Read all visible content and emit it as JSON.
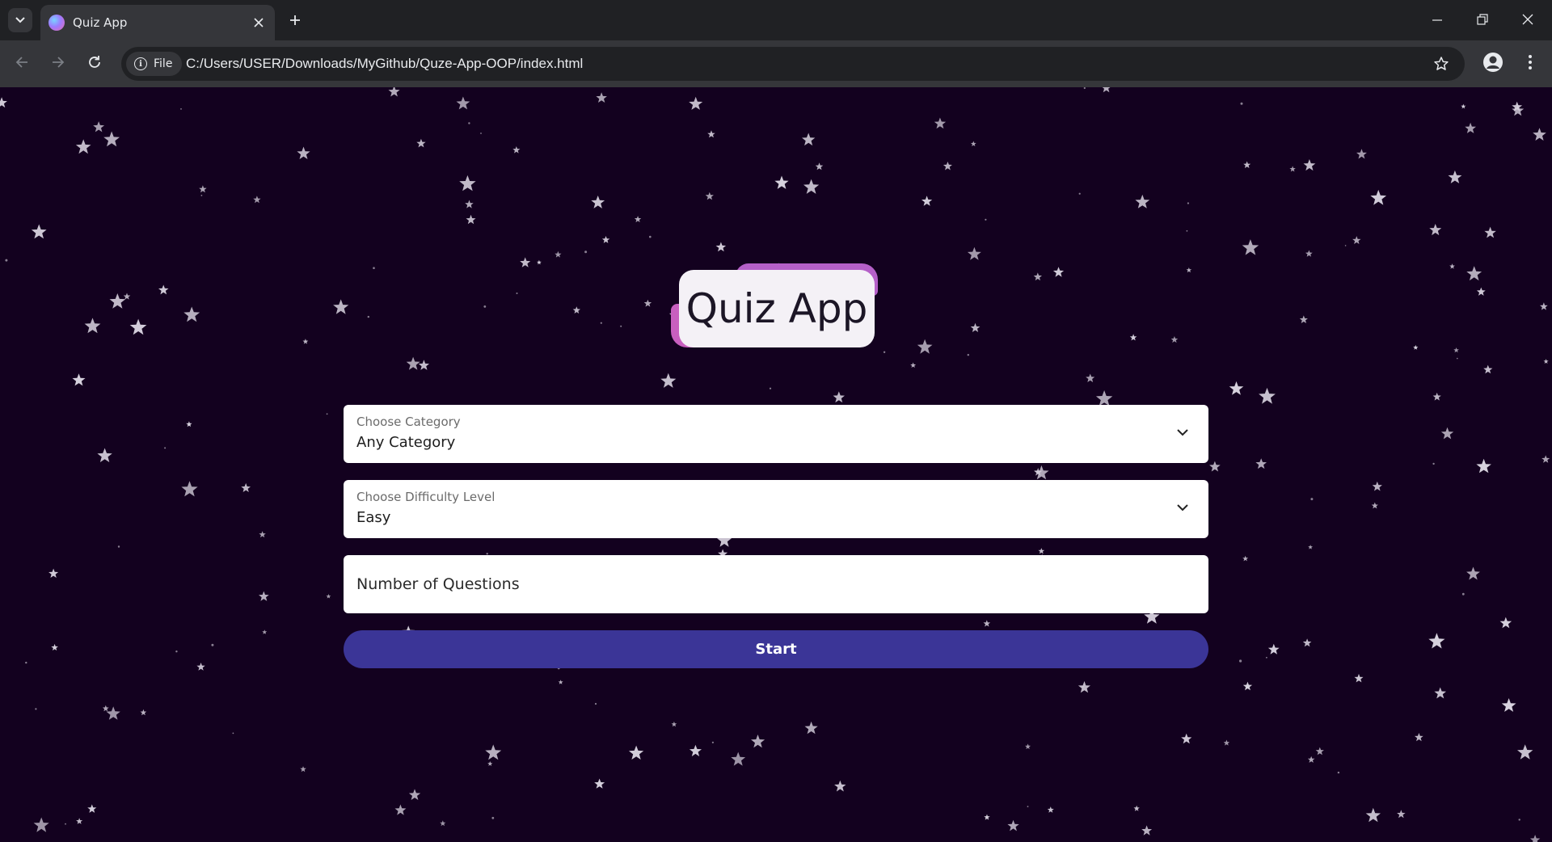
{
  "browser": {
    "tab_title": "Quiz App",
    "site_chip_label": "File",
    "url": "C:/Users/USER/Downloads/MyGithub/Quze-App-OOP/index.html",
    "icons": {
      "tab_search": "chevron-down-icon",
      "close_tab": "close-icon",
      "new_tab": "plus-icon",
      "minimize": "minimize-icon",
      "restore": "restore-icon",
      "close_window": "close-icon",
      "back": "arrow-left-icon",
      "forward": "arrow-right-icon",
      "reload": "reload-icon",
      "site_info": "info-icon",
      "bookmark": "star-icon",
      "profile": "profile-icon",
      "menu": "kebab-menu-icon"
    }
  },
  "app": {
    "title": "Quiz App",
    "category": {
      "label": "Choose Category",
      "value": "Any Category"
    },
    "difficulty": {
      "label": "Choose Difficulty Level",
      "value": "Easy"
    },
    "questions": {
      "placeholder": "Number of Questions"
    },
    "start_label": "Start"
  },
  "colors": {
    "background": "#13011f",
    "start_button": "#3b3597",
    "logo_accent": "#c85fbf",
    "star": "#d9d3e0"
  }
}
